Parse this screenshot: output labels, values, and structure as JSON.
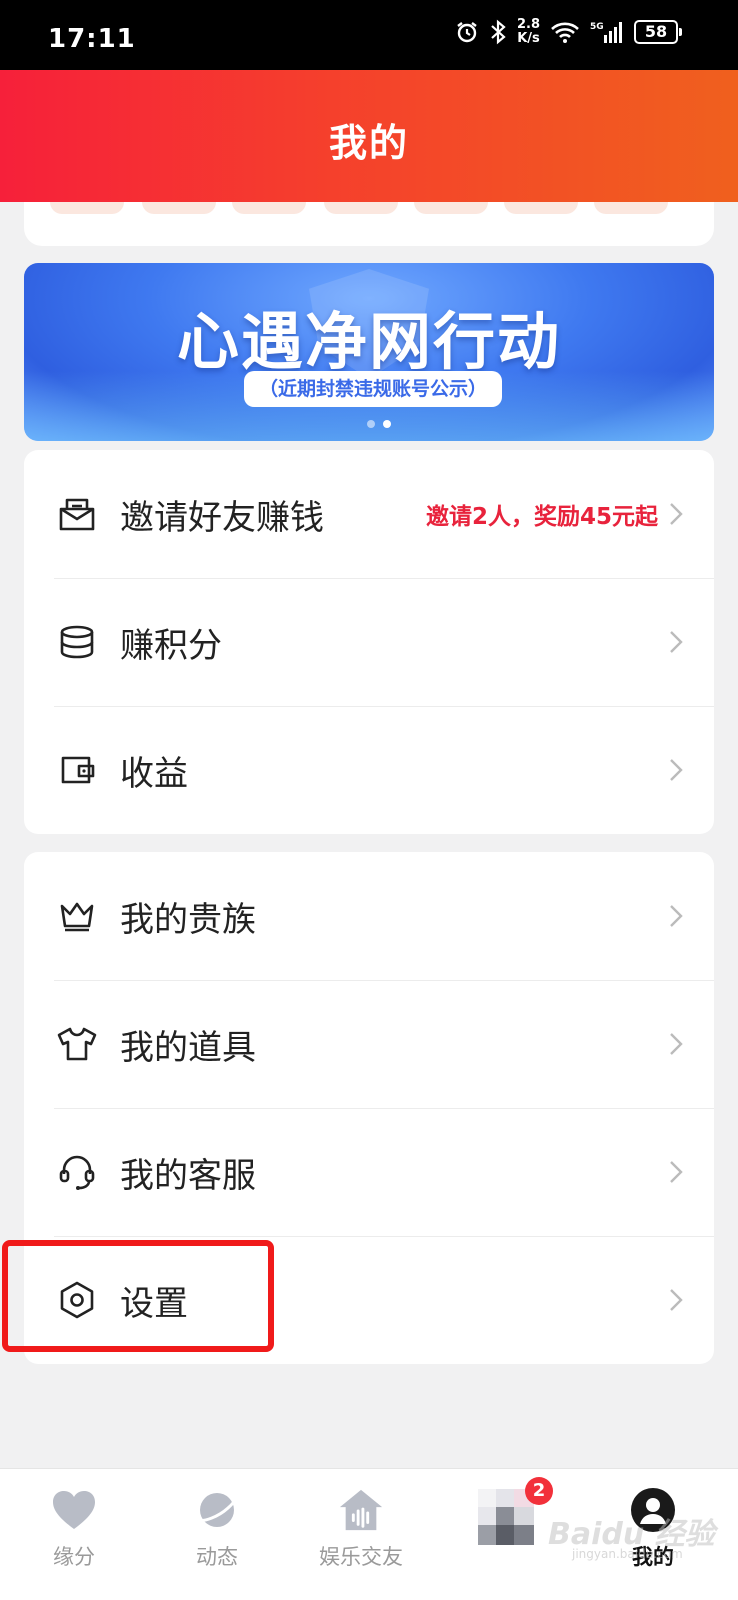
{
  "status_bar": {
    "time": "17:11",
    "speed_value": "2.8",
    "speed_unit": "K/s",
    "battery": "58"
  },
  "header": {
    "title": "我的"
  },
  "banner": {
    "headline": "心遇净网行动",
    "subtitle": "（近期封禁违规账号公示）"
  },
  "menu_group_1": [
    {
      "label": "邀请好友赚钱",
      "extra": "邀请2人，奖励45元起",
      "icon": "envelope-icon"
    },
    {
      "label": "赚积分",
      "extra": "",
      "icon": "coins-stack-icon"
    },
    {
      "label": "收益",
      "extra": "",
      "icon": "wallet-icon"
    }
  ],
  "menu_group_2": [
    {
      "label": "我的贵族",
      "icon": "crown-icon"
    },
    {
      "label": "我的道具",
      "icon": "shirt-icon"
    },
    {
      "label": "我的客服",
      "icon": "headset-icon"
    },
    {
      "label": "设置",
      "icon": "settings-hexagon-icon"
    }
  ],
  "bottom_nav": [
    {
      "label": "缘分",
      "icon": "heart-icon",
      "active": false
    },
    {
      "label": "动态",
      "icon": "planet-icon",
      "active": false
    },
    {
      "label": "娱乐交友",
      "icon": "house-wave-icon",
      "active": false
    },
    {
      "label": "",
      "icon": "message-avatar-icon",
      "badge": "2",
      "active": false
    },
    {
      "label": "我的",
      "icon": "profile-icon",
      "active": true
    }
  ],
  "colors": {
    "header_gradient_start": "#f6203a",
    "header_gradient_end": "#f0601e",
    "accent_red": "#e8233c",
    "banner_blue": "#3f79f0"
  }
}
